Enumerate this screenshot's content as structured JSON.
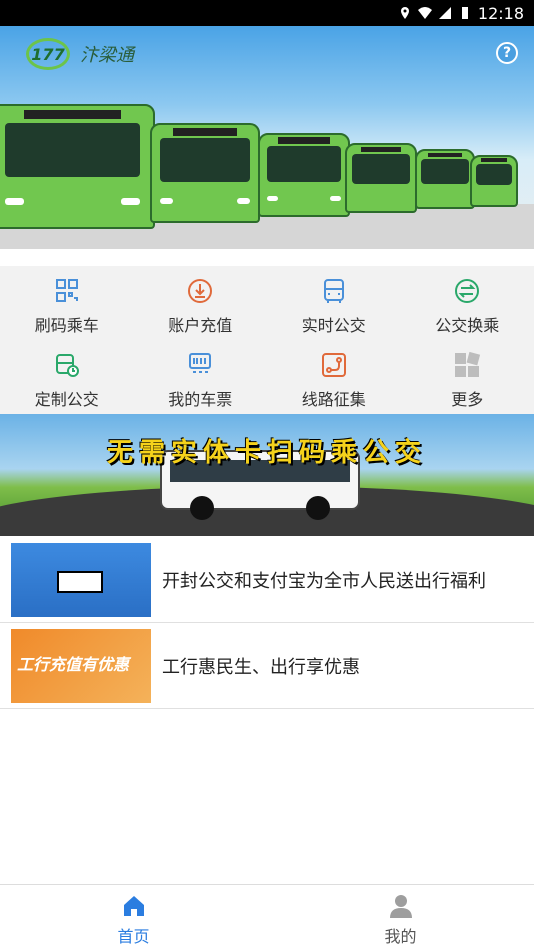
{
  "status_bar": {
    "time": "12:18"
  },
  "header": {
    "app_name": "汴梁通",
    "logo_text": "177"
  },
  "menu": [
    {
      "label": "刷码乘车",
      "icon": "qr-scan-icon",
      "color": "#4a90d9"
    },
    {
      "label": "账户充值",
      "icon": "recharge-icon",
      "color": "#e06a3b"
    },
    {
      "label": "实时公交",
      "icon": "bus-icon",
      "color": "#4a90d9"
    },
    {
      "label": "公交换乘",
      "icon": "transfer-icon",
      "color": "#2aa86a"
    },
    {
      "label": "定制公交",
      "icon": "custom-bus-icon",
      "color": "#2aa86a"
    },
    {
      "label": "我的车票",
      "icon": "ticket-icon",
      "color": "#4a90d9"
    },
    {
      "label": "线路征集",
      "icon": "route-icon",
      "color": "#e06a3b"
    },
    {
      "label": "更多",
      "icon": "more-grid-icon",
      "color": "#bdbdbd"
    }
  ],
  "banner": {
    "text": "无需实体卡扫码乘公交"
  },
  "news": [
    {
      "title": "开封公交和支付宝为全市人民送出行福利",
      "thumb": "alipay-promo"
    },
    {
      "title": "工行惠民生、出行享优惠",
      "thumb_text": "工行充值有优惠"
    }
  ],
  "tabs": [
    {
      "label": "首页",
      "icon": "home-icon",
      "active": true
    },
    {
      "label": "我的",
      "icon": "person-icon",
      "active": false
    }
  ],
  "colors": {
    "active_tab": "#2b7de0",
    "inactive_tab": "#777777",
    "accent_green": "#71c74f"
  }
}
